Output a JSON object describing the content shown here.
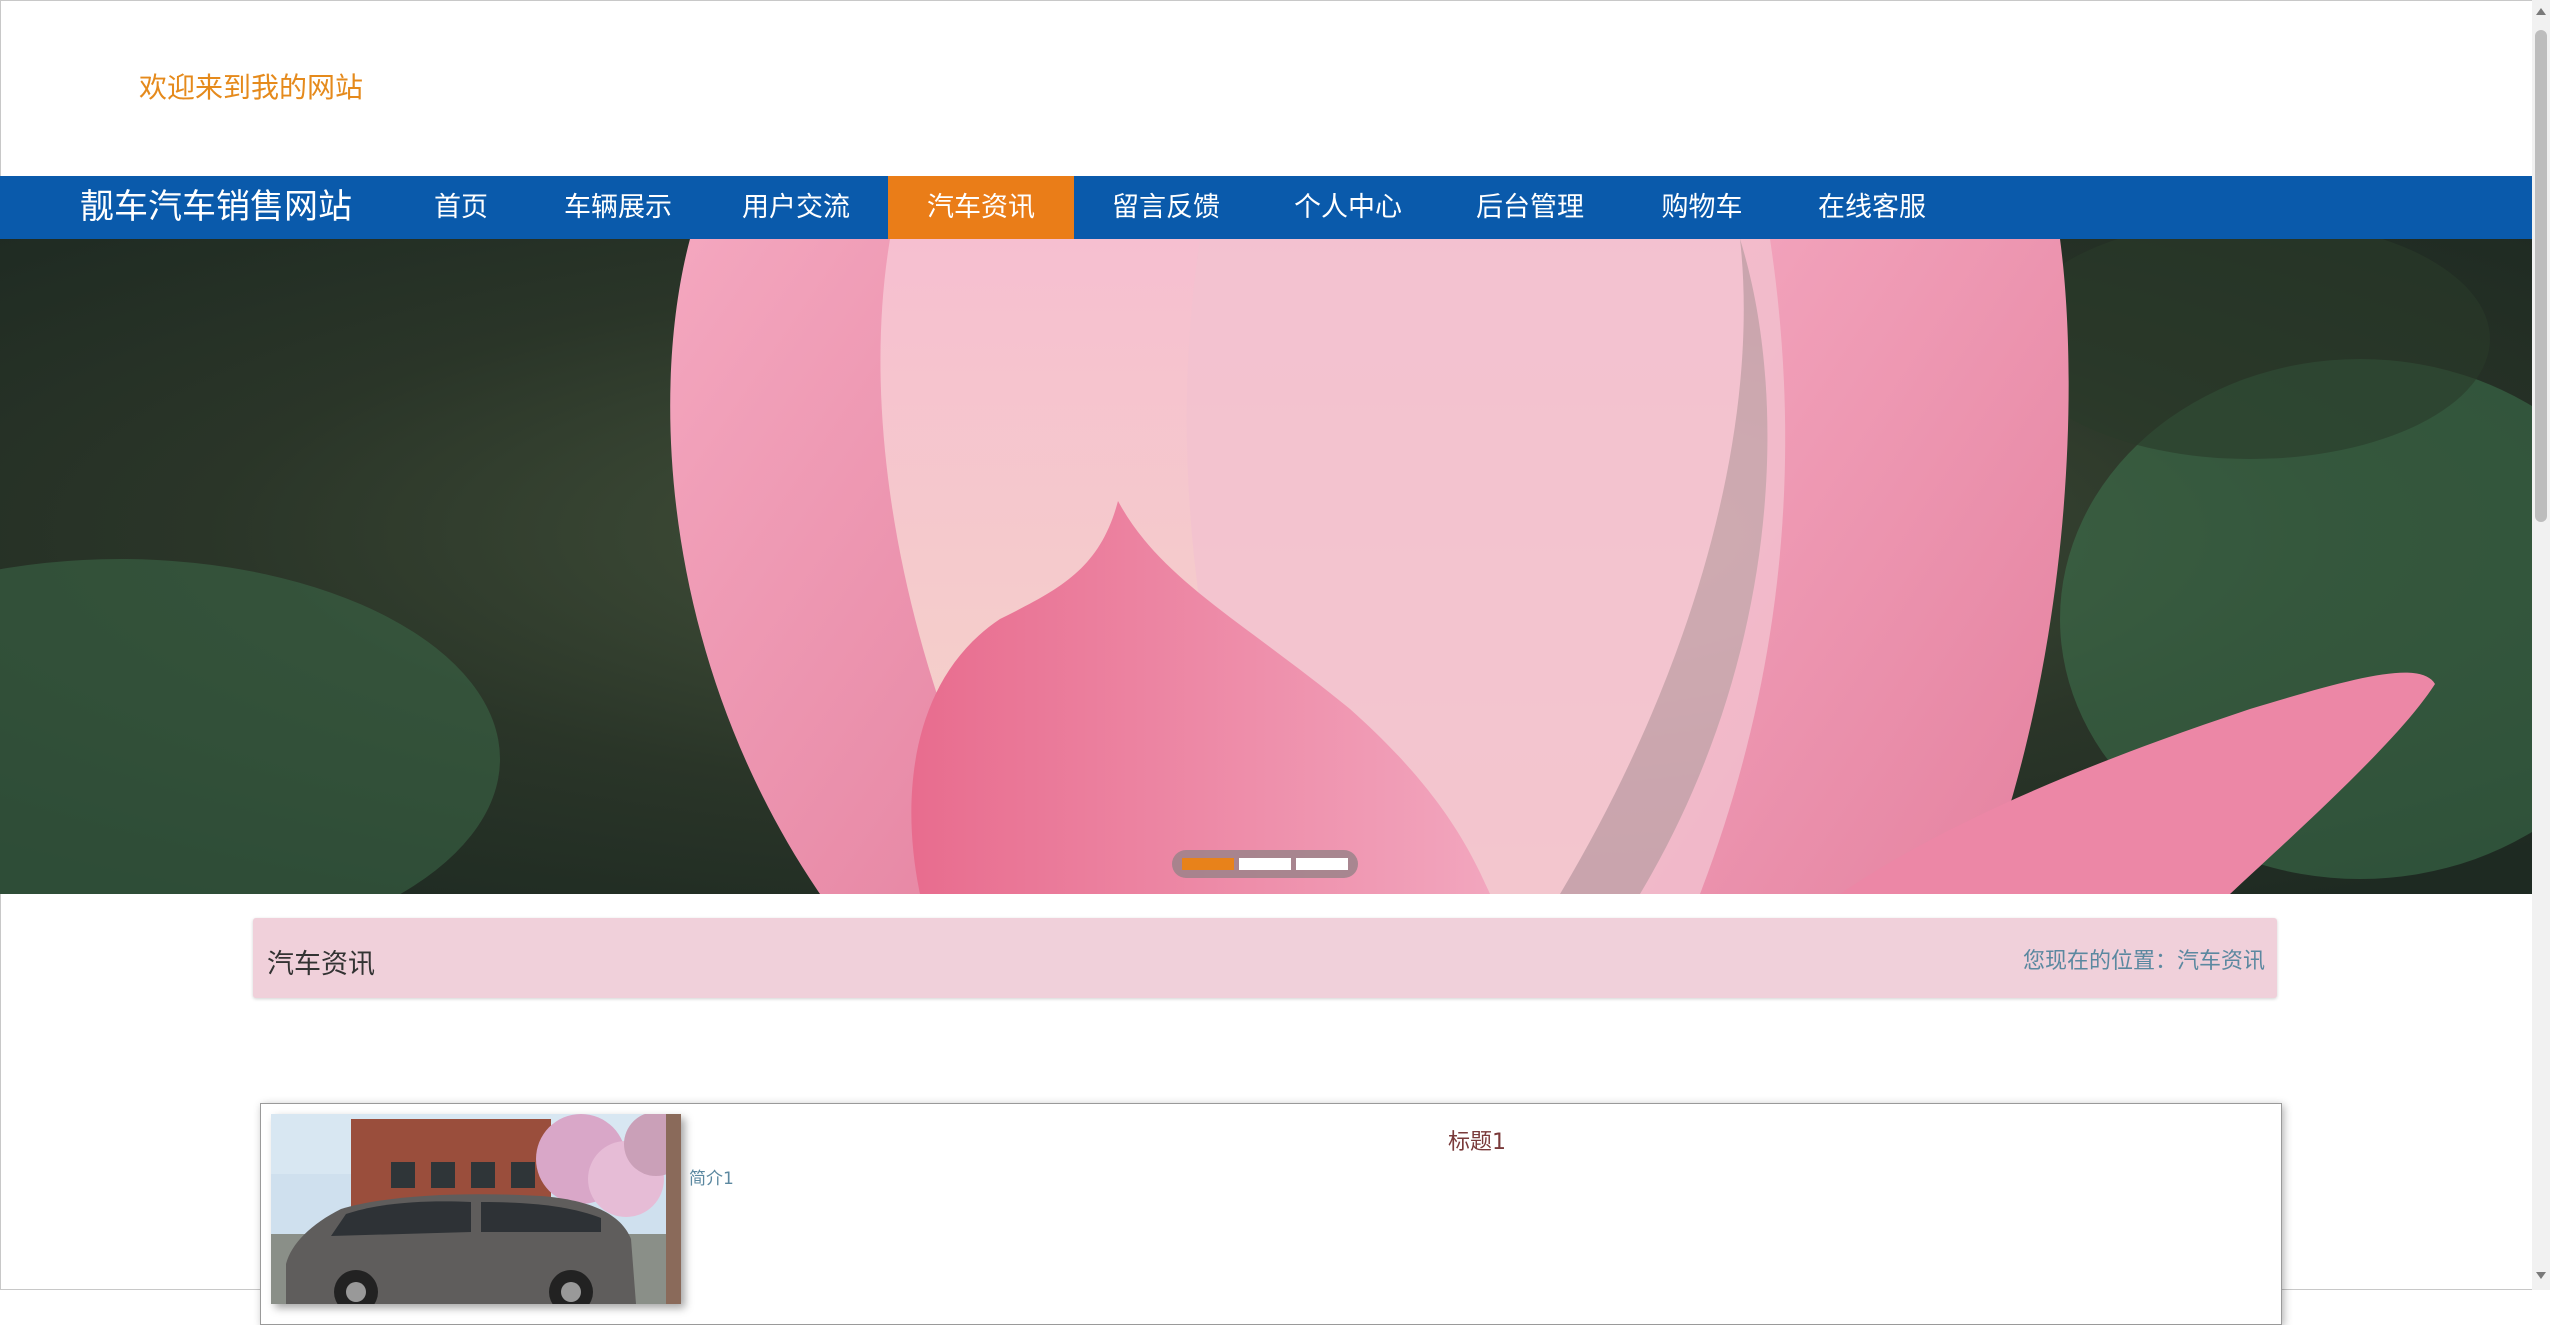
{
  "header": {
    "welcome": "欢迎来到我的网站"
  },
  "nav": {
    "site_title": "靓车汽车销售网站",
    "items": [
      {
        "label": "首页"
      },
      {
        "label": "车辆展示"
      },
      {
        "label": "用户交流"
      },
      {
        "label": "汽车资讯",
        "active": true
      },
      {
        "label": "留言反馈"
      },
      {
        "label": "个人中心"
      },
      {
        "label": "后台管理"
      },
      {
        "label": "购物车"
      },
      {
        "label": "在线客服"
      }
    ]
  },
  "banner": {
    "image": "pink-lotus-bud-photo",
    "slide_count": 3,
    "active_slide": 1
  },
  "breadcrumb": {
    "title": "汽车资讯",
    "location": "您现在的位置：汽车资讯"
  },
  "articles": [
    {
      "title": "标题1",
      "summary": "简介1",
      "image": "gray-minivan-photo"
    }
  ],
  "colors": {
    "accent": "#ea7d18",
    "nav_bg": "#0a5aab",
    "crumb_bg": "#f0d0da",
    "link": "#5b88a0"
  }
}
